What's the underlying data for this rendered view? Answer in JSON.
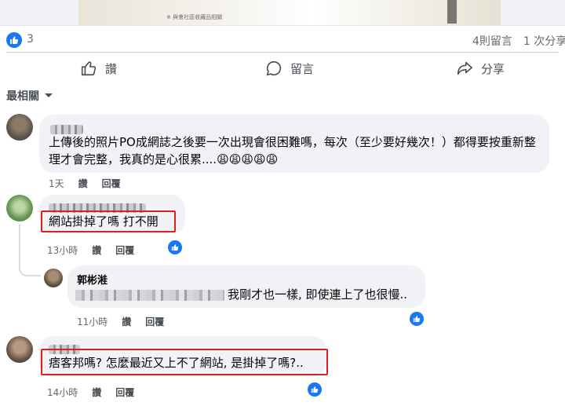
{
  "post": {
    "image_caption": "※ 與會社區收藏品相關",
    "reaction_count": "3",
    "comments_count": "4則留言",
    "shares_count": "1 次分享"
  },
  "actions": {
    "like_label": "讚",
    "comment_label": "留言",
    "share_label": "分享"
  },
  "sort": {
    "label": "最相關"
  },
  "comments": [
    {
      "text": "上傳後的照片PO成網誌之後要一次出現會很困難嗎，每次（至少要好幾次！）都得要按重新整理才會完整，我真的是心很累....😩😩😩😩😩",
      "time": "1天",
      "like": "讚",
      "reply": "回覆"
    },
    {
      "text": "網站掛掉了嗎 打不開",
      "time": "13小時",
      "like": "讚",
      "reply": "回覆",
      "reply_item": {
        "name": "郭彬溎",
        "text": "我剛才也一樣, 即使連上了也很慢..",
        "time": "11小時",
        "like": "讚",
        "reply": "回覆"
      }
    },
    {
      "text": "痞客邦嗎? 怎麼最近又上不了網站, 是掛掉了嗎?..",
      "time": "14小時",
      "like": "讚",
      "reply": "回覆"
    }
  ],
  "colors": {
    "brand_blue": "#1877f2",
    "highlight_red": "#e02020",
    "bubble_gray": "#f0f2f5"
  }
}
